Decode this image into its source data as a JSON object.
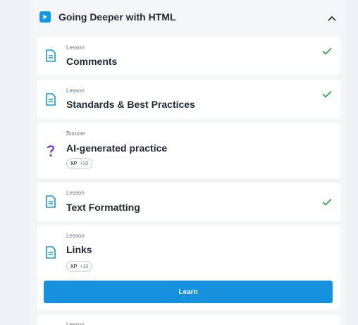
{
  "section": {
    "title": "Going Deeper with HTML",
    "icon": "play-icon",
    "collapse_icon": "chevron-up-icon",
    "accent": "#1598e1"
  },
  "items": [
    {
      "kind": "Lesson",
      "title": "Comments",
      "completed": true,
      "icon": "lesson-document-icon"
    },
    {
      "kind": "Lesson",
      "title": "Standards & Best Practices",
      "completed": true,
      "icon": "lesson-document-icon"
    },
    {
      "kind": "Booster",
      "title": "AI-generated practice",
      "completed": false,
      "icon": "question-mark-icon",
      "xp_label": "XP",
      "xp_value": "+20"
    },
    {
      "kind": "Lesson",
      "title": "Text Formatting",
      "completed": true,
      "icon": "lesson-document-icon"
    },
    {
      "kind": "Lesson",
      "title": "Links",
      "completed": false,
      "icon": "lesson-document-icon",
      "xp_label": "XP",
      "xp_value": "+10",
      "action_label": "Learn"
    },
    {
      "kind": "Lesson",
      "title": "",
      "completed": false,
      "icon": "lesson-document-icon"
    }
  ],
  "colors": {
    "check": "#2ea84a",
    "button": "#1591dd",
    "booster": "#7b3fc4"
  }
}
